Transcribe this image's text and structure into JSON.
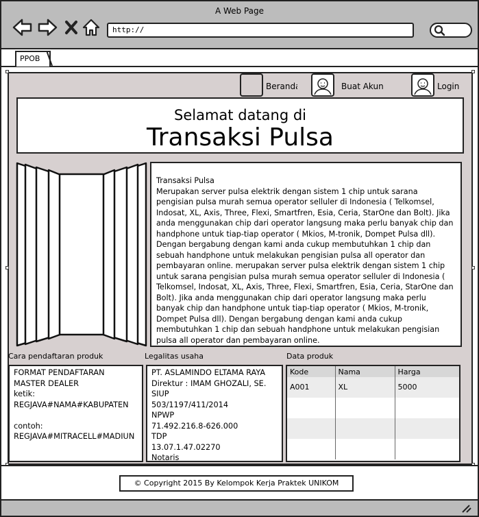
{
  "window": {
    "title": "A Web Page"
  },
  "address_bar": {
    "url": "http://"
  },
  "tabs": [
    {
      "label": "PPOB"
    }
  ],
  "top_nav": {
    "beranda": "Beranda",
    "buat_akun": "Buat Akun",
    "login": "Login"
  },
  "welcome": {
    "line1": "Selamat datang di",
    "line2": "Transaksi Pulsa"
  },
  "description": {
    "title": "Transaksi Pulsa",
    "body": "Merupakan server pulsa elektrik dengan sistem 1 chip untuk sarana pengisian pulsa murah semua operator selluler di Indonesia ( Telkomsel, Indosat, XL, Axis, Three, Flexi, Smartfren, Esia, Ceria, StarOne dan Bolt). Jika anda menggunakan chip dari operator langsung maka perlu banyak chip dan handphone untuk tiap-tiap operator ( Mkios, M-tronik, Dompet Pulsa dll). Dengan bergabung dengan kami anda cukup membutuhkan 1 chip dan sebuah handphone untuk melakukan pengisian pulsa all operator dan pembayaran online. merupakan server pulsa elektrik dengan sistem 1 chip untuk sarana pengisian pulsa murah semua operator selluler di Indonesia ( Telkomsel, Indosat, XL, Axis, Three, Flexi, Smartfren, Esia, Ceria, StarOne dan Bolt). Jika anda menggunakan chip dari operator langsung maka perlu banyak chip dan handphone untuk tiap-tiap operator ( Mkios, M-tronik, Dompet Pulsa dll). Dengan bergabung dengan kami anda cukup membutuhkan 1 chip dan sebuah handphone untuk melakukan pengisian pulsa all operator dan pembayaran online."
  },
  "sections": {
    "cara": {
      "label": "Cara pendaftaran produk",
      "text": "FORMAT PENDAFTARAN\nMASTER DEALER\nketik:\nREGJAVA#NAMA#KABUPATEN\n\ncontoh:\nREGJAVA#MITRACELL#MADIUN"
    },
    "legalitas": {
      "label": "Legalitas usaha",
      "text": "PT. ASLAMINDO ELTAMA RAYA\nDirektur : IMAM GHOZALI, SE.\nSIUP\n503/1197/411/2014\nNPWP\n71.492.216.8-626.000\nTDP\n13.07.1.47.02270\nNotaris"
    },
    "data": {
      "label": "Data produk",
      "columns": [
        "Kode",
        "Nama",
        "Harga"
      ],
      "rows": [
        [
          "A001",
          "XL",
          "5000"
        ],
        [
          "",
          "",
          ""
        ],
        [
          "",
          "",
          ""
        ],
        [
          "",
          "",
          ""
        ]
      ]
    }
  },
  "footer": {
    "copyright": "© Copyright 2015 By Kelompok Kerja Praktek UNIKOM"
  }
}
